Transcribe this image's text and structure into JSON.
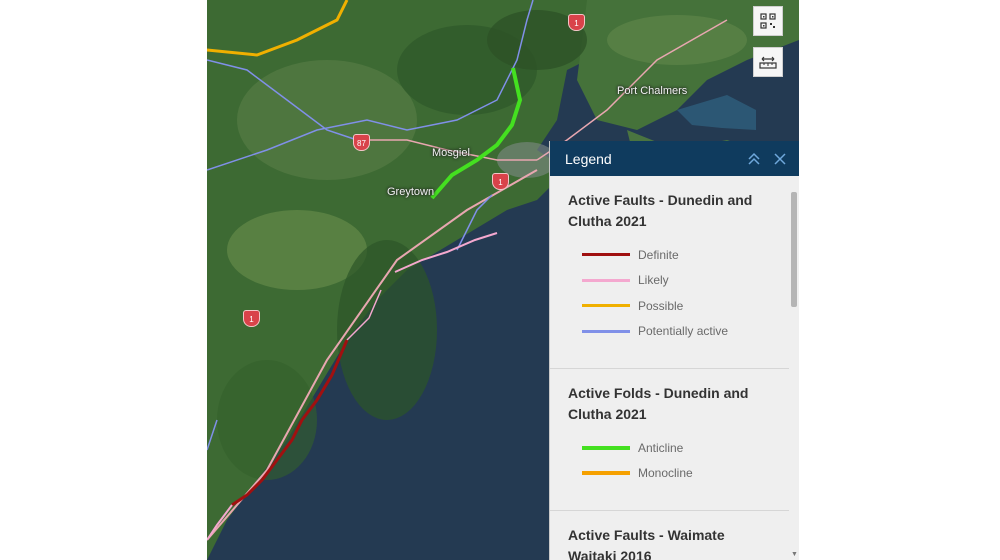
{
  "map": {
    "labels": {
      "port_chalmers": "Port Chalmers",
      "mosgiel": "Mosgiel",
      "greytown": "Greytown"
    },
    "highway_shields": [
      "1",
      "87",
      "1",
      "1"
    ],
    "colors": {
      "land": "#3f6b35",
      "sea": "#253a52",
      "road": "#e8a7b0"
    }
  },
  "toolbar": {
    "select_icon": "qr-select-icon",
    "measure_icon": "measure-icon"
  },
  "legend": {
    "title": "Legend",
    "layers": [
      {
        "title": "Active Faults - Dunedin and Clutha 2021",
        "entries": [
          {
            "label": "Definite",
            "color": "#a01010"
          },
          {
            "label": "Likely",
            "color": "#f4a8cf"
          },
          {
            "label": "Possible",
            "color": "#f0b000"
          },
          {
            "label": "Potentially active",
            "color": "#8090e8"
          }
        ]
      },
      {
        "title": "Active Folds - Dunedin and Clutha 2021",
        "entries": [
          {
            "label": "Anticline",
            "color": "#44e020"
          },
          {
            "label": "Monocline",
            "color": "#f5a000"
          }
        ]
      },
      {
        "title": "Active Faults - Waimate Waitaki 2016",
        "entries": []
      }
    ]
  }
}
